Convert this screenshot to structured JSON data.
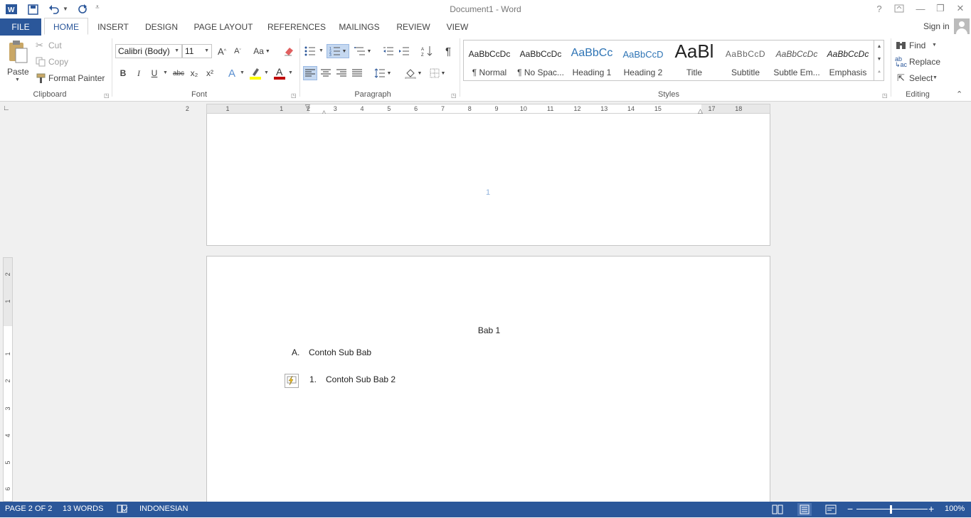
{
  "window": {
    "title": "Document1 - Word"
  },
  "titlebar": {
    "help": "?",
    "minimize": "—",
    "restore": "❐",
    "close": "✕"
  },
  "tabs": [
    {
      "label": "FILE"
    },
    {
      "label": "HOME"
    },
    {
      "label": "INSERT"
    },
    {
      "label": "DESIGN"
    },
    {
      "label": "PAGE LAYOUT"
    },
    {
      "label": "REFERENCES"
    },
    {
      "label": "MAILINGS"
    },
    {
      "label": "REVIEW"
    },
    {
      "label": "VIEW"
    }
  ],
  "account": {
    "sign_in": "Sign in"
  },
  "clipboard": {
    "paste": "Paste",
    "cut": "Cut",
    "copy": "Copy",
    "format_painter": "Format Painter",
    "group": "Clipboard"
  },
  "font": {
    "name": "Calibri (Body)",
    "size": "11",
    "group": "Font",
    "bold": "B",
    "italic": "I",
    "underline": "U",
    "strike": "abc",
    "sub": "x₂",
    "sup": "x²",
    "grow": "A",
    "shrink": "A",
    "case": "Aa"
  },
  "paragraph": {
    "group": "Paragraph",
    "pilcrow": "¶"
  },
  "styles": {
    "group": "Styles",
    "items": [
      {
        "preview": "AaBbCcDc",
        "name": "¶ Normal"
      },
      {
        "preview": "AaBbCcDc",
        "name": "¶ No Spac..."
      },
      {
        "preview": "AaBbCc",
        "name": "Heading 1"
      },
      {
        "preview": "AaBbCcD",
        "name": "Heading 2"
      },
      {
        "preview": "AaBl",
        "name": "Title"
      },
      {
        "preview": "AaBbCcD",
        "name": "Subtitle"
      },
      {
        "preview": "AaBbCcDc",
        "name": "Subtle Em..."
      },
      {
        "preview": "AaBbCcDc",
        "name": "Emphasis"
      }
    ]
  },
  "editing": {
    "group": "Editing",
    "find": "Find",
    "replace": "Replace",
    "select": "Select"
  },
  "ruler": {
    "numbers": [
      "2",
      "1",
      "1",
      "2",
      "3",
      "4",
      "5",
      "6",
      "7",
      "8",
      "9",
      "10",
      "11",
      "12",
      "13",
      "14",
      "15",
      "",
      "17",
      "18"
    ]
  },
  "vruler": {
    "numbers": [
      "2",
      "1",
      "1",
      "2",
      "3",
      "4",
      "5",
      "6"
    ]
  },
  "page1": {
    "page_number": "1"
  },
  "page2": {
    "heading": "Bab 1",
    "item_a_marker": "A.",
    "item_a_text": "Contoh Sub Bab",
    "item_1_marker": "1.",
    "item_1_text": "Contoh Sub Bab 2"
  },
  "status": {
    "page": "PAGE 2 OF 2",
    "words": "13 WORDS",
    "language": "INDONESIAN",
    "zoom": "100%"
  },
  "colors": {
    "accent": "#2b579a",
    "highlight": "#ffff00",
    "font_color": "#c00000"
  }
}
